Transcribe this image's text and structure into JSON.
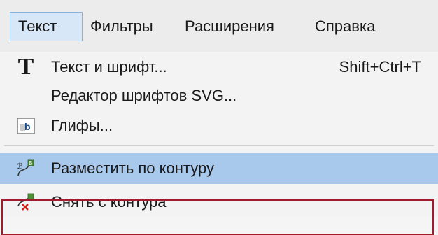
{
  "menubar": {
    "items": [
      {
        "label": "Текст",
        "active": true
      },
      {
        "label": "Фильтры",
        "active": false
      },
      {
        "label": "Расширения",
        "active": false
      },
      {
        "label": "Справка",
        "active": false
      }
    ]
  },
  "menu": {
    "items": [
      {
        "label": "Текст и шрифт...",
        "shortcut": "Shift+Ctrl+T",
        "icon": "text-font-icon"
      },
      {
        "label": "Редактор шрифтов SVG...",
        "shortcut": "",
        "icon": ""
      },
      {
        "label": "Глифы...",
        "shortcut": "",
        "icon": "glyphs-icon"
      },
      {
        "label": "Разместить по контуру",
        "shortcut": "",
        "icon": "put-on-path-icon",
        "highlighted": true
      },
      {
        "label": "Снять с контура",
        "shortcut": "",
        "icon": "remove-from-path-icon"
      }
    ]
  },
  "colors": {
    "highlight": "#a8c8ec",
    "active_menubar": "#d7e7f7",
    "annotation_box": "#a01c2c"
  }
}
